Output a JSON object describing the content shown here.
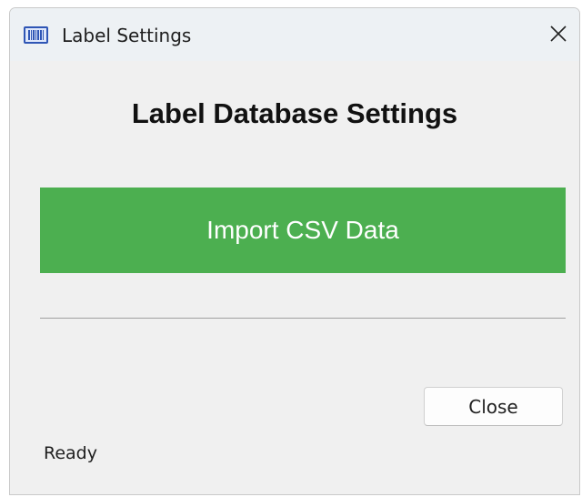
{
  "window": {
    "title": "Label Settings",
    "app_icon": "barcode-icon",
    "close_icon": "close-icon"
  },
  "main": {
    "heading": "Label Database Settings",
    "import_button_label": "Import CSV Data",
    "close_button_label": "Close"
  },
  "status_bar": {
    "text": "Ready"
  },
  "colors": {
    "import_button_bg": "#4caf50",
    "import_button_text": "#ffffff",
    "window_bg": "#f0f0f0",
    "titlebar_bg": "#edf1f4"
  }
}
